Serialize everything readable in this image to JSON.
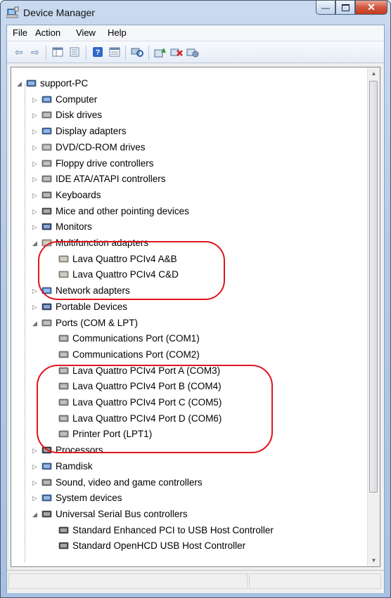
{
  "window": {
    "title": "Device Manager"
  },
  "menu": [
    {
      "label": "File"
    },
    {
      "label": "Action"
    },
    {
      "label": "View"
    },
    {
      "label": "Help"
    }
  ],
  "toolbar_icons": [
    "back-icon",
    "forward-icon",
    "properties-icon",
    "show-hide-console-tree-icon",
    "help-icon",
    "details-icon",
    "scan-hardware-icon",
    "update-driver-icon",
    "uninstall-icon",
    "disable-icon"
  ],
  "tree": {
    "root": "support-PC",
    "categories": [
      {
        "label": "Computer"
      },
      {
        "label": "Disk drives"
      },
      {
        "label": "Display adapters"
      },
      {
        "label": "DVD/CD-ROM drives"
      },
      {
        "label": "Floppy drive controllers"
      },
      {
        "label": "IDE ATA/ATAPI controllers"
      },
      {
        "label": "Keyboards"
      },
      {
        "label": "Mice and other pointing devices"
      },
      {
        "label": "Monitors"
      },
      {
        "label": "Multifunction adapters",
        "children": [
          "Lava Quattro PCIv4 A&B",
          "Lava Quattro PCIv4 C&D"
        ]
      },
      {
        "label": "Network adapters"
      },
      {
        "label": "Portable Devices"
      },
      {
        "label": "Ports (COM & LPT)",
        "children": [
          "Communications Port (COM1)",
          "Communications Port (COM2)",
          "Lava Quattro PCIv4 Port A (COM3)",
          "Lava Quattro PCIv4 Port B (COM4)",
          "Lava Quattro PCIv4 Port C (COM5)",
          "Lava Quattro PCIv4 Port D (COM6)",
          "Printer Port (LPT1)"
        ]
      },
      {
        "label": "Processors"
      },
      {
        "label": "Ramdisk"
      },
      {
        "label": "Sound, video and game controllers"
      },
      {
        "label": "System devices"
      },
      {
        "label": "Universal Serial Bus controllers",
        "children": [
          "Standard Enhanced PCI to USB Host Controller",
          "Standard OpenHCD USB Host Controller"
        ]
      }
    ]
  },
  "colors": {
    "highlight_ring": "#e0151b",
    "close_button": "#c23a1d"
  }
}
